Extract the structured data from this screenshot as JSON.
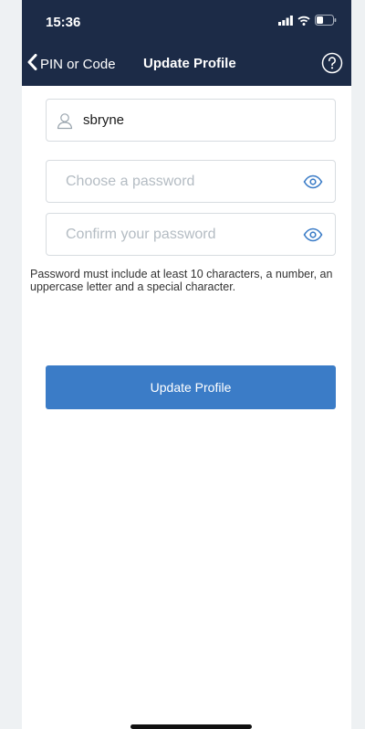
{
  "status_bar": {
    "time": "15:36",
    "icons": [
      "signal-icon",
      "wifi-icon",
      "battery-icon"
    ]
  },
  "nav": {
    "back_label": "PIN or Code",
    "title": "Update Profile",
    "help_icon": "help-icon"
  },
  "form": {
    "username": {
      "value": "sbryne",
      "icon": "user-icon"
    },
    "password": {
      "value": "",
      "placeholder": "Choose a password",
      "toggle_icon": "eye-icon"
    },
    "confirm_password": {
      "value": "",
      "placeholder": "Confirm your password",
      "toggle_icon": "eye-icon"
    },
    "hint": "Password must include at least 10 characters, a number, an uppercase letter and a special character.",
    "submit_label": "Update Profile"
  },
  "colors": {
    "header_bg": "#1c2b47",
    "accent": "#3b7cc7",
    "page_bg": "#eef1f3"
  }
}
